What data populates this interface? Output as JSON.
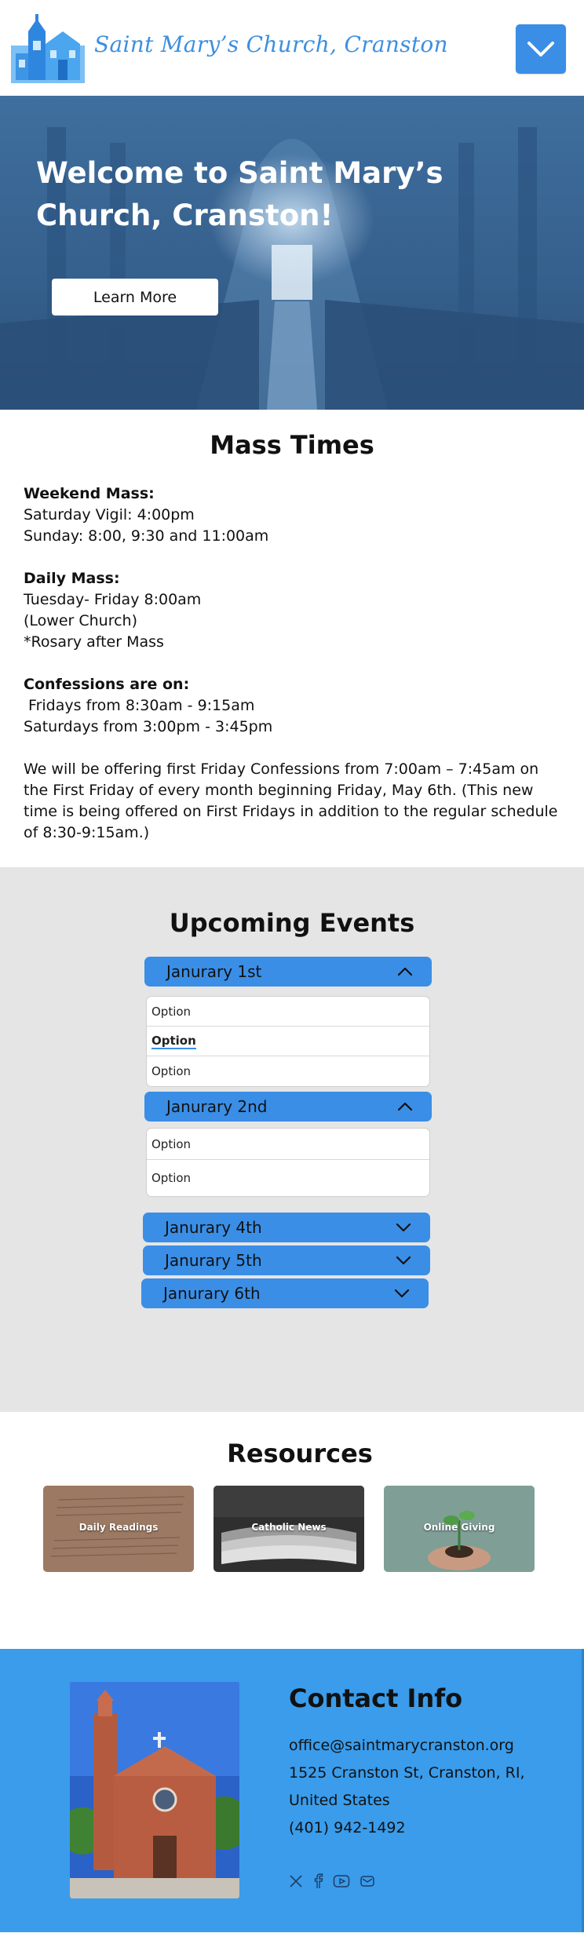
{
  "header": {
    "site_name": "Saint Mary’s Church, Cranston",
    "menu_icon": "chevron-down-icon",
    "colors": {
      "accent": "#3a8ee6",
      "brand_text": "#3d8fe0"
    }
  },
  "hero": {
    "title": "Welcome to Saint Mary’s Church, Cranston!",
    "button_label": "Learn More"
  },
  "mass_times": {
    "title": "Mass Times",
    "groups": [
      {
        "heading": "Weekend Mass:",
        "lines": [
          "Saturday Vigil: 4:00pm",
          "Sunday: 8:00, 9:30 and 11:00am"
        ]
      },
      {
        "heading": "Daily Mass:",
        "lines": [
          "Tuesday- Friday 8:00am",
          "(Lower Church)",
          "*Rosary after Mass"
        ]
      },
      {
        "heading": "Confessions are on:",
        "lines": [
          " Fridays from 8:30am - 9:15am",
          "Saturdays from 3:00pm - 3:45pm"
        ]
      }
    ],
    "note": "We will be offering first Friday Confessions from 7:00am – 7:45am on the First Friday of every month beginning Friday, May 6th. (This new time is being offered on First Fridays in addition to the regular schedule of 8:30-9:15am.)"
  },
  "events": {
    "title": "Upcoming Events",
    "items": [
      {
        "label": "Janurary 1st",
        "expanded": true,
        "options": [
          "Option",
          "Option",
          "Option"
        ],
        "active_option": 1
      },
      {
        "label": "Janurary 2nd",
        "expanded": true,
        "options": [
          "Option",
          "Option"
        ],
        "active_option": -1
      },
      {
        "label": "Janurary 4th",
        "expanded": false,
        "options": []
      },
      {
        "label": "Janurary 5th",
        "expanded": false,
        "options": []
      },
      {
        "label": "Janurary 6th",
        "expanded": false,
        "options": []
      }
    ]
  },
  "resources": {
    "title": "Resources",
    "cards": [
      {
        "label": "Daily Readings"
      },
      {
        "label": "Catholic News"
      },
      {
        "label": "Online Giving"
      }
    ]
  },
  "contact": {
    "title": "Contact Info",
    "email": "office@saintmarycranston.org",
    "address": "1525 Cranston St, Cranston, RI, United States",
    "phone": "(401) 942-1492",
    "social_icons": [
      "x-icon",
      "facebook-icon",
      "youtube-icon",
      "email-icon"
    ]
  }
}
